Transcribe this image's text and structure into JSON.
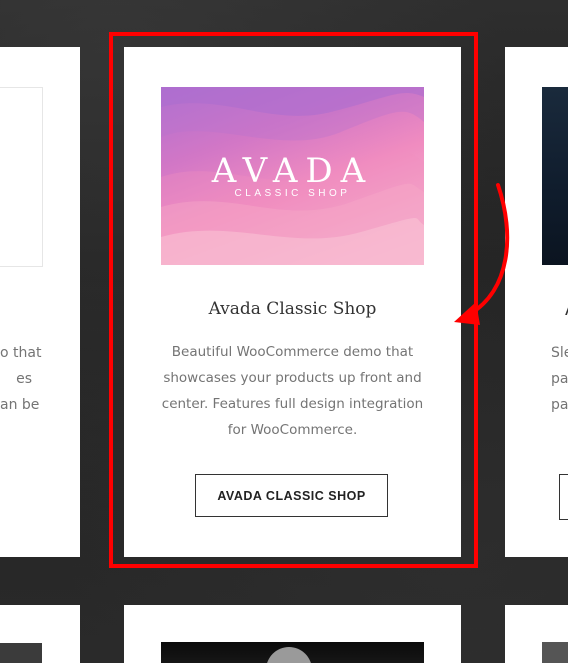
{
  "left_card": {
    "description": "o that\nes\nan be"
  },
  "center_card": {
    "thumbnail": {
      "logo_main": "AVADA",
      "logo_sub": "CLASSIC SHOP"
    },
    "title": "Avada Classic Shop",
    "description": "Beautiful WooCommerce demo that showcases your products up front and center. Features full design integration for WooCommerce.",
    "button_label": "AVADA CLASSIC SHOP"
  },
  "right_card": {
    "title": "A",
    "description": "Sle\npag\npage"
  },
  "colors": {
    "highlight": "#ff0000",
    "background": "#262626",
    "card": "#ffffff",
    "text": "#333333",
    "muted_text": "#747474"
  },
  "icons": {
    "annotation_arrow": "curved-arrow-icon"
  }
}
